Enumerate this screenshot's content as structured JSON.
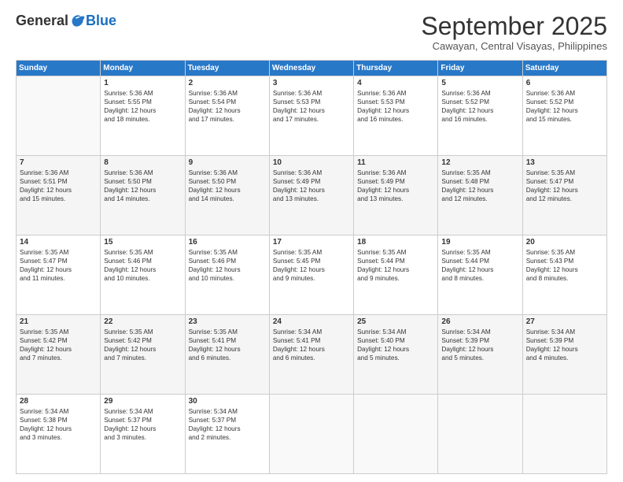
{
  "header": {
    "logo": {
      "general": "General",
      "blue": "Blue"
    },
    "title": "September 2025",
    "location": "Cawayan, Central Visayas, Philippines"
  },
  "calendar": {
    "days_of_week": [
      "Sunday",
      "Monday",
      "Tuesday",
      "Wednesday",
      "Thursday",
      "Friday",
      "Saturday"
    ],
    "weeks": [
      [
        {
          "day": "",
          "info": ""
        },
        {
          "day": "1",
          "info": "Sunrise: 5:36 AM\nSunset: 5:55 PM\nDaylight: 12 hours\nand 18 minutes."
        },
        {
          "day": "2",
          "info": "Sunrise: 5:36 AM\nSunset: 5:54 PM\nDaylight: 12 hours\nand 17 minutes."
        },
        {
          "day": "3",
          "info": "Sunrise: 5:36 AM\nSunset: 5:53 PM\nDaylight: 12 hours\nand 17 minutes."
        },
        {
          "day": "4",
          "info": "Sunrise: 5:36 AM\nSunset: 5:53 PM\nDaylight: 12 hours\nand 16 minutes."
        },
        {
          "day": "5",
          "info": "Sunrise: 5:36 AM\nSunset: 5:52 PM\nDaylight: 12 hours\nand 16 minutes."
        },
        {
          "day": "6",
          "info": "Sunrise: 5:36 AM\nSunset: 5:52 PM\nDaylight: 12 hours\nand 15 minutes."
        }
      ],
      [
        {
          "day": "7",
          "info": "Sunrise: 5:36 AM\nSunset: 5:51 PM\nDaylight: 12 hours\nand 15 minutes."
        },
        {
          "day": "8",
          "info": "Sunrise: 5:36 AM\nSunset: 5:50 PM\nDaylight: 12 hours\nand 14 minutes."
        },
        {
          "day": "9",
          "info": "Sunrise: 5:36 AM\nSunset: 5:50 PM\nDaylight: 12 hours\nand 14 minutes."
        },
        {
          "day": "10",
          "info": "Sunrise: 5:36 AM\nSunset: 5:49 PM\nDaylight: 12 hours\nand 13 minutes."
        },
        {
          "day": "11",
          "info": "Sunrise: 5:36 AM\nSunset: 5:49 PM\nDaylight: 12 hours\nand 13 minutes."
        },
        {
          "day": "12",
          "info": "Sunrise: 5:35 AM\nSunset: 5:48 PM\nDaylight: 12 hours\nand 12 minutes."
        },
        {
          "day": "13",
          "info": "Sunrise: 5:35 AM\nSunset: 5:47 PM\nDaylight: 12 hours\nand 12 minutes."
        }
      ],
      [
        {
          "day": "14",
          "info": "Sunrise: 5:35 AM\nSunset: 5:47 PM\nDaylight: 12 hours\nand 11 minutes."
        },
        {
          "day": "15",
          "info": "Sunrise: 5:35 AM\nSunset: 5:46 PM\nDaylight: 12 hours\nand 10 minutes."
        },
        {
          "day": "16",
          "info": "Sunrise: 5:35 AM\nSunset: 5:46 PM\nDaylight: 12 hours\nand 10 minutes."
        },
        {
          "day": "17",
          "info": "Sunrise: 5:35 AM\nSunset: 5:45 PM\nDaylight: 12 hours\nand 9 minutes."
        },
        {
          "day": "18",
          "info": "Sunrise: 5:35 AM\nSunset: 5:44 PM\nDaylight: 12 hours\nand 9 minutes."
        },
        {
          "day": "19",
          "info": "Sunrise: 5:35 AM\nSunset: 5:44 PM\nDaylight: 12 hours\nand 8 minutes."
        },
        {
          "day": "20",
          "info": "Sunrise: 5:35 AM\nSunset: 5:43 PM\nDaylight: 12 hours\nand 8 minutes."
        }
      ],
      [
        {
          "day": "21",
          "info": "Sunrise: 5:35 AM\nSunset: 5:42 PM\nDaylight: 12 hours\nand 7 minutes."
        },
        {
          "day": "22",
          "info": "Sunrise: 5:35 AM\nSunset: 5:42 PM\nDaylight: 12 hours\nand 7 minutes."
        },
        {
          "day": "23",
          "info": "Sunrise: 5:35 AM\nSunset: 5:41 PM\nDaylight: 12 hours\nand 6 minutes."
        },
        {
          "day": "24",
          "info": "Sunrise: 5:34 AM\nSunset: 5:41 PM\nDaylight: 12 hours\nand 6 minutes."
        },
        {
          "day": "25",
          "info": "Sunrise: 5:34 AM\nSunset: 5:40 PM\nDaylight: 12 hours\nand 5 minutes."
        },
        {
          "day": "26",
          "info": "Sunrise: 5:34 AM\nSunset: 5:39 PM\nDaylight: 12 hours\nand 5 minutes."
        },
        {
          "day": "27",
          "info": "Sunrise: 5:34 AM\nSunset: 5:39 PM\nDaylight: 12 hours\nand 4 minutes."
        }
      ],
      [
        {
          "day": "28",
          "info": "Sunrise: 5:34 AM\nSunset: 5:38 PM\nDaylight: 12 hours\nand 3 minutes."
        },
        {
          "day": "29",
          "info": "Sunrise: 5:34 AM\nSunset: 5:37 PM\nDaylight: 12 hours\nand 3 minutes."
        },
        {
          "day": "30",
          "info": "Sunrise: 5:34 AM\nSunset: 5:37 PM\nDaylight: 12 hours\nand 2 minutes."
        },
        {
          "day": "",
          "info": ""
        },
        {
          "day": "",
          "info": ""
        },
        {
          "day": "",
          "info": ""
        },
        {
          "day": "",
          "info": ""
        }
      ]
    ]
  }
}
